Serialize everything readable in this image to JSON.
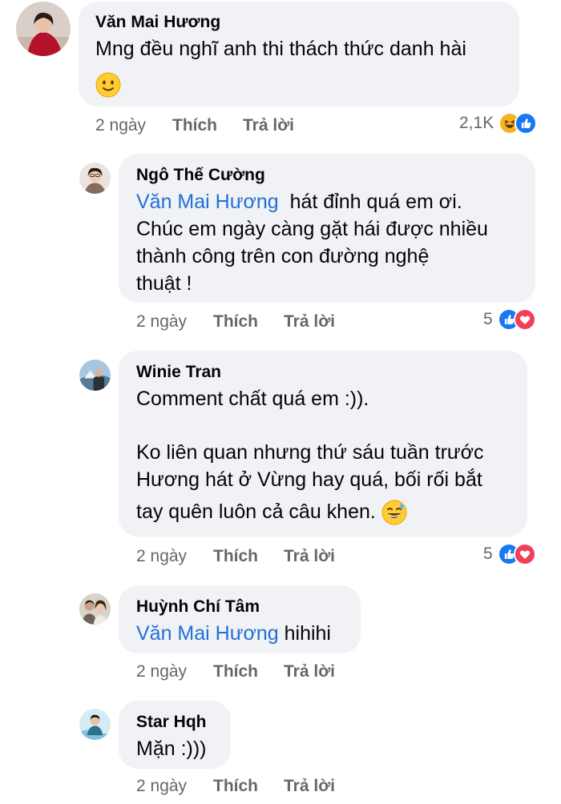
{
  "comments": [
    {
      "author": "Văn Mai Hương",
      "line1": "Mng đều nghĩ anh thi thách thức danh hài",
      "emoji": "slightly-smiling-face",
      "time": "2 ngày",
      "like": "Thích",
      "reply": "Trả lời",
      "reaction_count": "2,1K",
      "reactions": [
        "haha-icon",
        "like-icon"
      ]
    },
    {
      "author": "Ngô Thế Cường",
      "mention": "Văn Mai Hương",
      "line1_rest": "hát đỉnh quá em ơi.",
      "line2": "Chúc em ngày càng gặt hái được nhiều",
      "line3": "thành công trên con đường  nghệ",
      "line4": "thuật !",
      "time": "2 ngày",
      "like": "Thích",
      "reply": "Trả lời",
      "reaction_count": "5",
      "reactions": [
        "like-icon",
        "love-icon"
      ]
    },
    {
      "author": "Winie Tran",
      "line1": "Comment chất quá em :)).",
      "line2": "Ko liên quan nhưng thứ sáu tuần trước",
      "line3": "Hương hát ở Vừng hay quá, bối rối bắt",
      "line4": "tay quên luôn cả câu khen.",
      "emoji": "grinning-sweat-face",
      "time": "2 ngày",
      "like": "Thích",
      "reply": "Trả lời",
      "reaction_count": "5",
      "reactions": [
        "like-icon",
        "love-icon"
      ]
    },
    {
      "author": "Huỳnh Chí Tâm",
      "mention": "Văn Mai Hương",
      "line1_rest": "hihihi",
      "time": "2 ngày",
      "like": "Thích",
      "reply": "Trả lời"
    },
    {
      "author": "Star Hqh",
      "line1": "Mặn :)))",
      "time": "2 ngày",
      "like": "Thích",
      "reply": "Trả lời"
    }
  ],
  "colors": {
    "bubble": "#f0f2f5",
    "mention": "#216fdb",
    "meta": "#65676b",
    "like": "#1877f2",
    "love": "#f33e58",
    "haha": "#f7b125"
  }
}
